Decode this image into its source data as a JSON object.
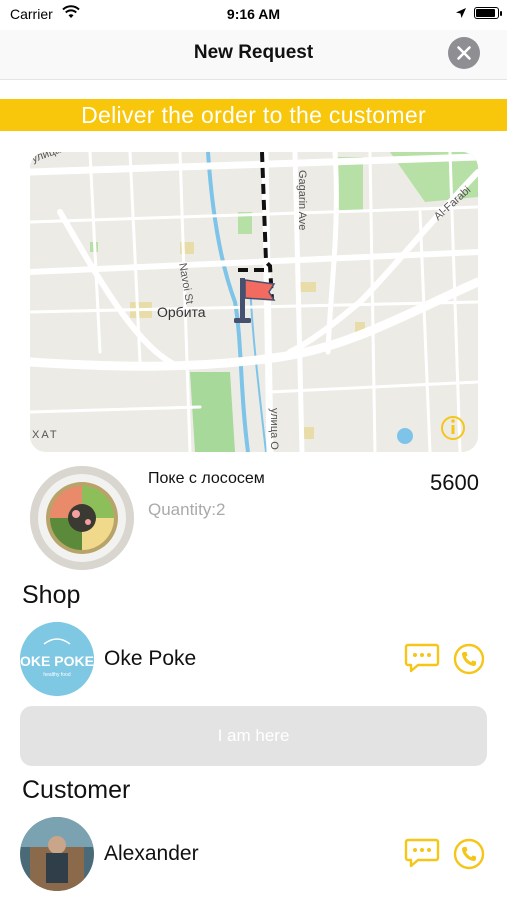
{
  "status_bar": {
    "carrier": "Carrier",
    "time": "9:16 AM"
  },
  "nav": {
    "title": "New Request"
  },
  "banner": {
    "text": "Deliver the order to the customer"
  },
  "map": {
    "labels": {
      "orbita": "Орбита",
      "navoi": "Navoi St",
      "gagarin": "Gagarin Ave",
      "alfarabi": "Al-Farabi",
      "ulitsa_top": "улица",
      "ulitsa_bottom": "улица О",
      "hat": "ХАТ"
    },
    "flag_color": "#f26b61",
    "route_color": "#111111"
  },
  "product": {
    "name": "Поке с лососем",
    "quantity": "Quantity:2",
    "price": "5600"
  },
  "shop": {
    "heading": "Shop",
    "name": "Oke Poke",
    "logo_text": "OKE POKE",
    "logo_subtext": "healthy food"
  },
  "arrive_button": {
    "label": "I am here"
  },
  "customer": {
    "heading": "Customer",
    "name": "Alexander"
  },
  "colors": {
    "accent": "#f8c60a",
    "icon_yellow": "#f5c518",
    "button_disabled": "#e3e3e3"
  }
}
